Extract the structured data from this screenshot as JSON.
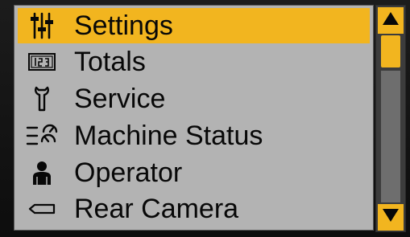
{
  "menu": {
    "items": [
      {
        "label": "Settings",
        "icon": "settings-icon",
        "selected": true
      },
      {
        "label": "Totals",
        "icon": "counter-icon",
        "selected": false
      },
      {
        "label": "Service",
        "icon": "wrench-icon",
        "selected": false
      },
      {
        "label": "Machine Status",
        "icon": "machine-status-icon",
        "selected": false
      },
      {
        "label": "Operator",
        "icon": "operator-icon",
        "selected": false
      },
      {
        "label": "Rear Camera",
        "icon": "camera-icon",
        "selected": false
      }
    ]
  },
  "scrollbar": {
    "up_icon": "arrow-up-icon",
    "down_icon": "arrow-down-icon"
  },
  "colors": {
    "accent": "#f2b51f",
    "panel": "#b3b3b3",
    "track": "#3c3c3c"
  }
}
